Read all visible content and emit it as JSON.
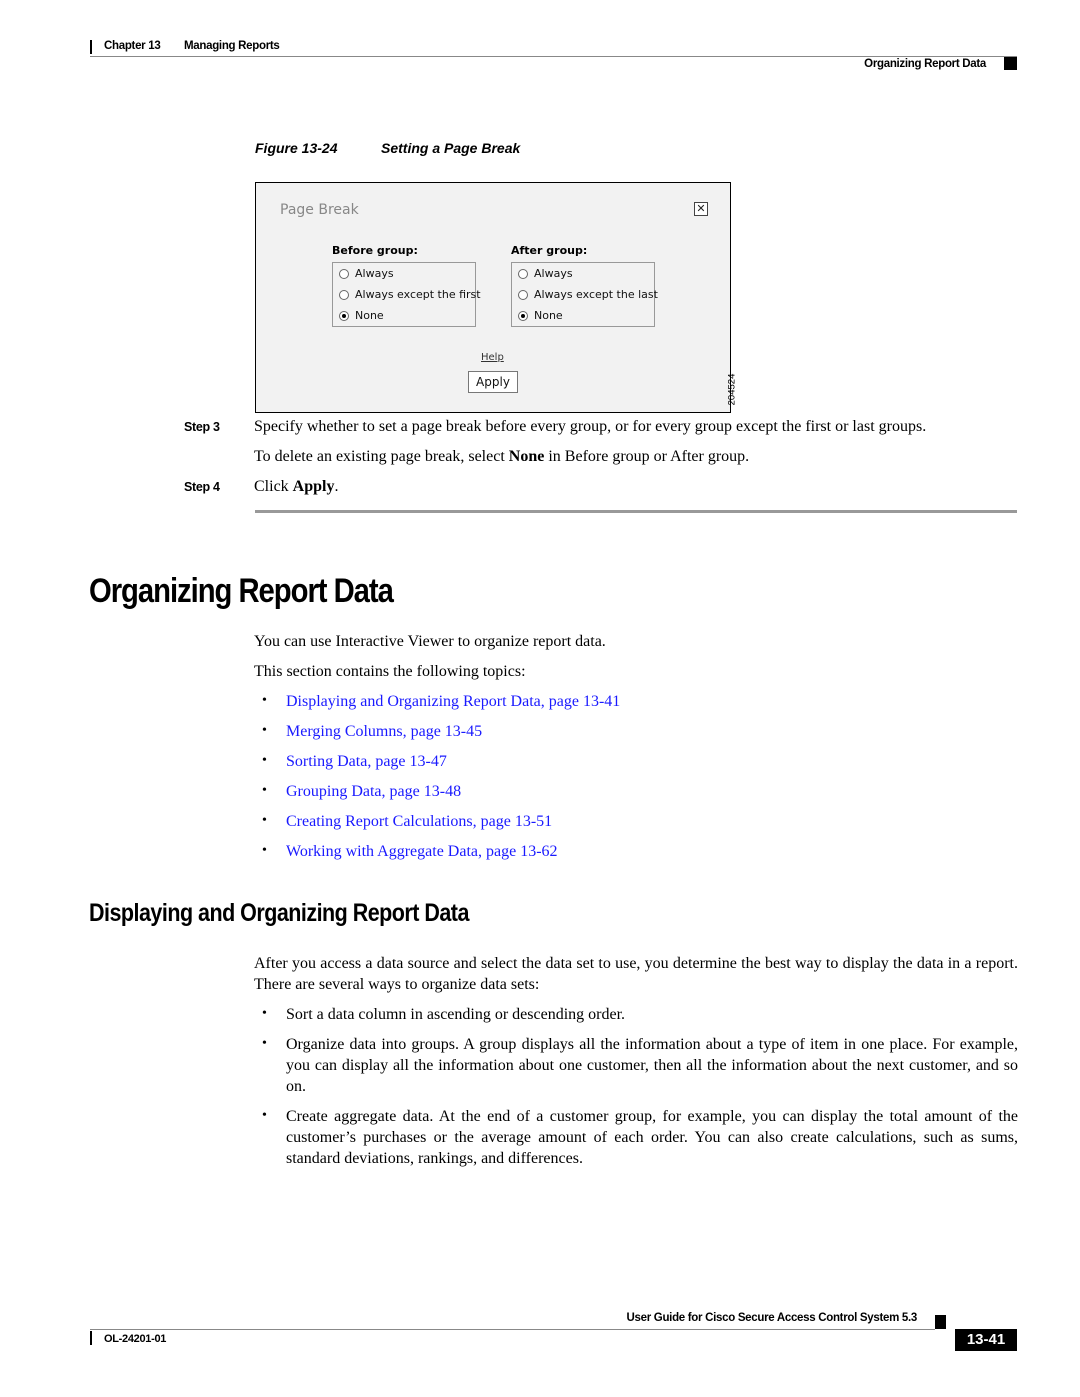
{
  "header": {
    "chapter": "Chapter 13",
    "chapter_title": "Managing Reports",
    "section": "Organizing Report Data"
  },
  "figure": {
    "number": "Figure 13-24",
    "title": "Setting a Page Break",
    "id": "204524",
    "dialog": {
      "title": "Page Break",
      "close_icon": "close-icon",
      "before_group": {
        "label": "Before group:",
        "options": [
          {
            "label": "Always",
            "checked": false
          },
          {
            "label": "Always except the first",
            "checked": false
          },
          {
            "label": "None",
            "checked": true
          }
        ]
      },
      "after_group": {
        "label": "After group:",
        "options": [
          {
            "label": "Always",
            "checked": false
          },
          {
            "label": "Always except the last",
            "checked": false
          },
          {
            "label": "None",
            "checked": true
          }
        ]
      },
      "help_link": "Help",
      "apply_label": "Apply"
    }
  },
  "steps": [
    {
      "label": "Step 3",
      "text": "Specify whether to set a page break before every group, or for every group except the first or last groups.",
      "note_pre": "To delete an existing page break, select ",
      "note_bold": "None",
      "note_post": " in Before group or After group."
    },
    {
      "label": "Step 4",
      "text_pre": "Click ",
      "text_bold": "Apply",
      "text_post": "."
    }
  ],
  "section": {
    "title": "Organizing Report Data",
    "intro": "You can use Interactive Viewer to organize report data.",
    "topics_intro": "This section contains the following topics:",
    "topics": [
      "Displaying and Organizing Report Data, page 13-41",
      "Merging Columns, page 13-45",
      "Sorting Data, page 13-47",
      "Grouping Data, page 13-48",
      "Creating Report Calculations, page 13-51",
      "Working with Aggregate Data, page 13-62"
    ]
  },
  "subsection": {
    "title": "Displaying and Organizing Report Data",
    "intro": "After you access a data source and select the data set to use, you determine the best way to display the data in a report. There are several ways to organize data sets:",
    "bullets": [
      "Sort a data column in ascending or descending order.",
      "Organize data into groups. A group displays all the information about a type of item in one place. For example, you can display all the information about one customer, then all the information about the next customer, and so on.",
      "Create aggregate data. At the end of a customer group, for example, you can display the total amount of the customer’s purchases or the average amount of each order. You can also create calculations, such as sums, standard deviations, rankings, and differences."
    ]
  },
  "footer": {
    "guide_title": "User Guide for Cisco Secure Access Control System 5.3",
    "doc_id": "OL-24201-01",
    "page_number": "13-41"
  },
  "colors": {
    "link": "#1a1aff",
    "dialog_bg": "#f2f2f2"
  }
}
